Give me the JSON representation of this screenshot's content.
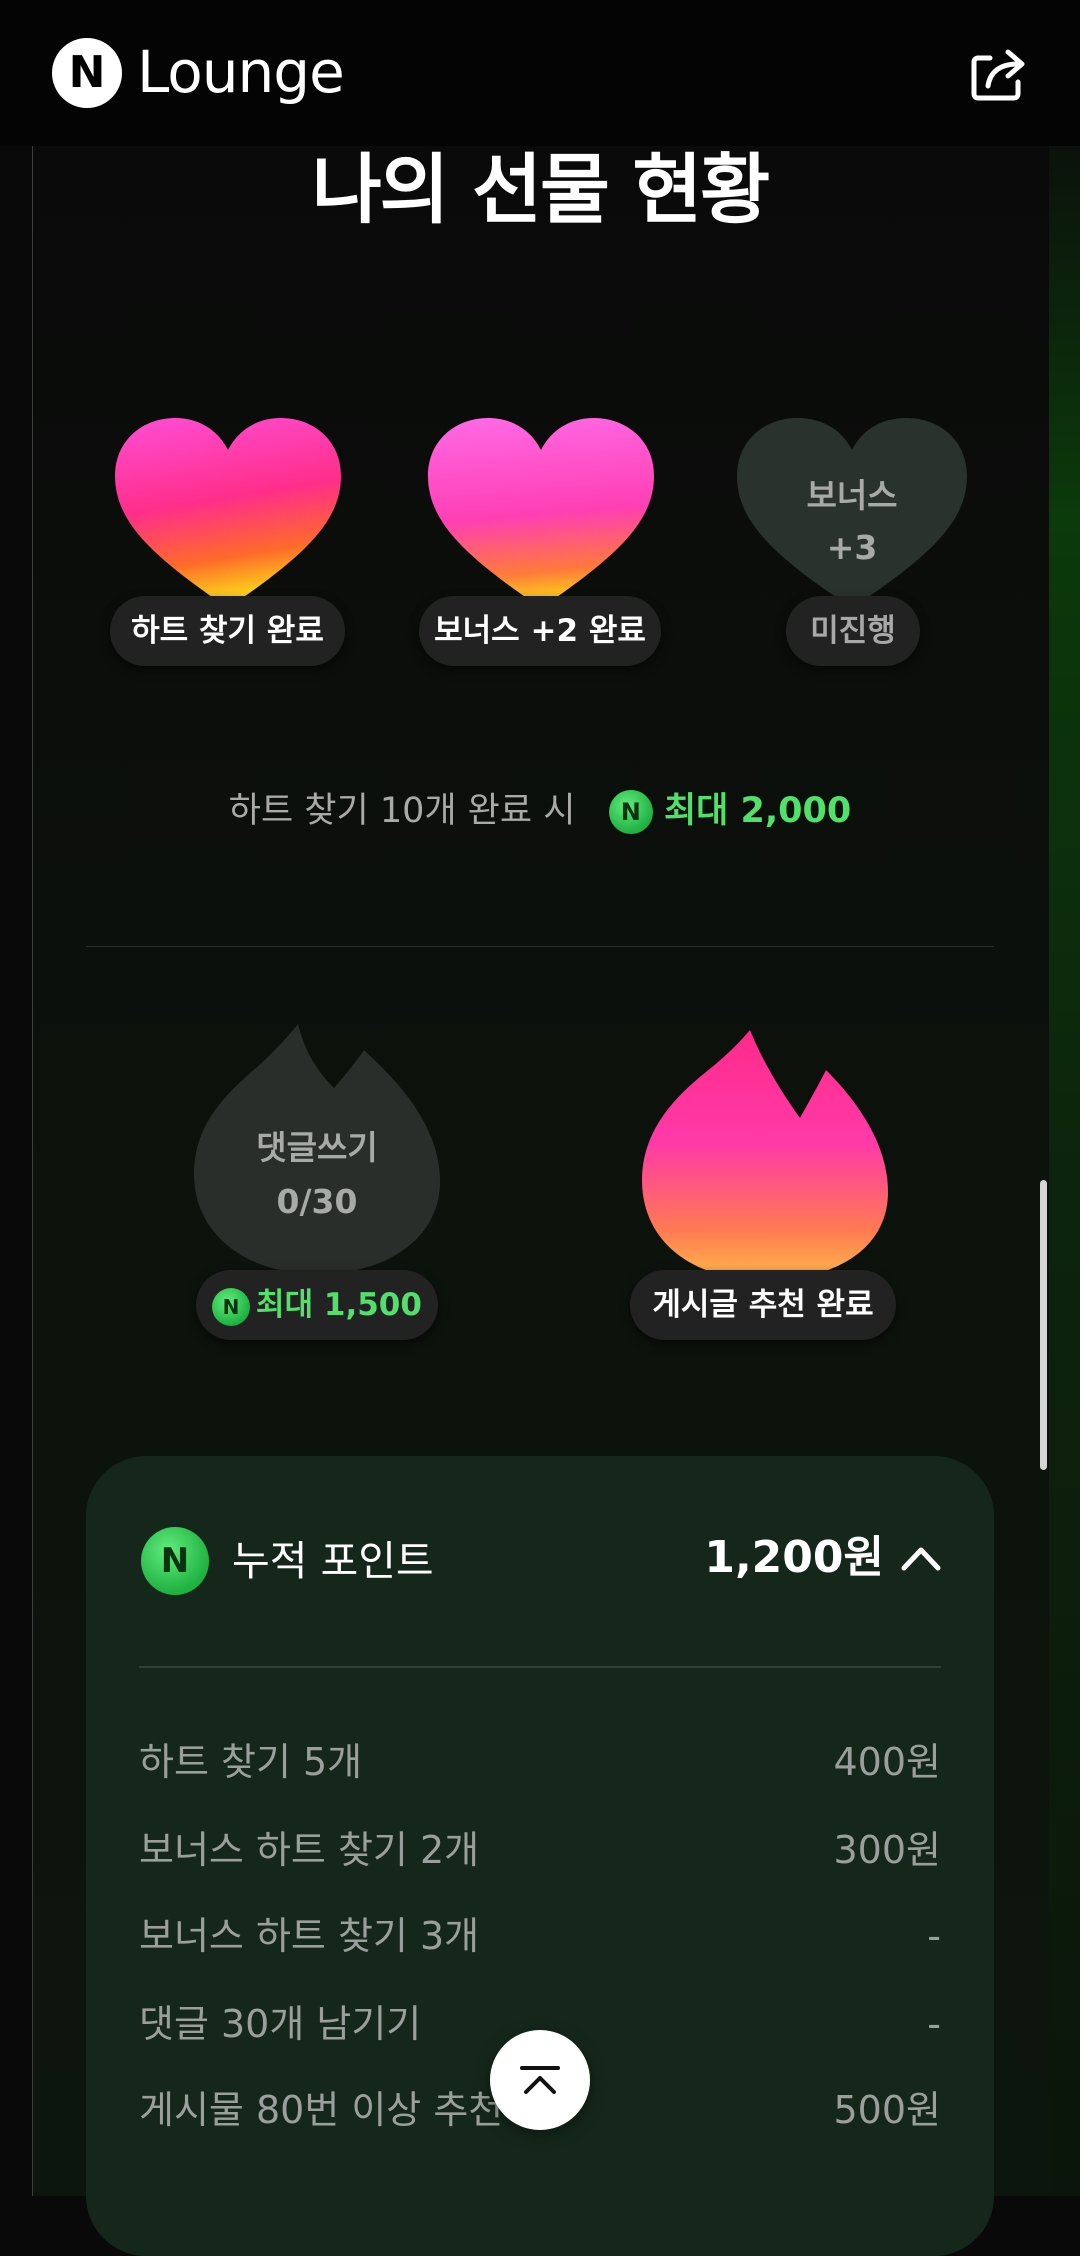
{
  "header": {
    "logo_letter": "N",
    "brand": "Lounge",
    "share_icon": "share-icon"
  },
  "title": "나의 선물 현황",
  "hearts": [
    {
      "label": "하트 찾기 완료",
      "state": "done"
    },
    {
      "label": "보너스 +2 완료",
      "state": "done"
    },
    {
      "label": "미진행",
      "state": "pending",
      "ghost_line1": "보너스",
      "ghost_line2": "+3"
    }
  ],
  "heart_reward": {
    "prefix": "하트 찾기 10개 완료 시",
    "coin_letter": "N",
    "amount": "최대 2,000"
  },
  "flames": [
    {
      "ghost_line1": "댓글쓰기",
      "ghost_line2": "0/30",
      "pill_coin": "N",
      "pill_label": "최대 1,500",
      "state": "pending"
    },
    {
      "pill_label": "게시글 추천 완료",
      "state": "done"
    }
  ],
  "points": {
    "coin_letter": "N",
    "title": "누적 포인트",
    "total": "1,200원",
    "rows": [
      {
        "label": "하트 찾기 5개",
        "value": "400원"
      },
      {
        "label": "보너스 하트 찾기 2개",
        "value": "300원"
      },
      {
        "label": "보너스 하트 찾기 3개",
        "value": "-"
      },
      {
        "label": "댓글 30개 남기기",
        "value": "-"
      },
      {
        "label": "게시물 80번 이상 추천",
        "value": "500원"
      }
    ]
  },
  "colors": {
    "accent_green": "#52e06c",
    "heart_pink": "#ff3fc0",
    "panel_bg": "#15271a"
  }
}
